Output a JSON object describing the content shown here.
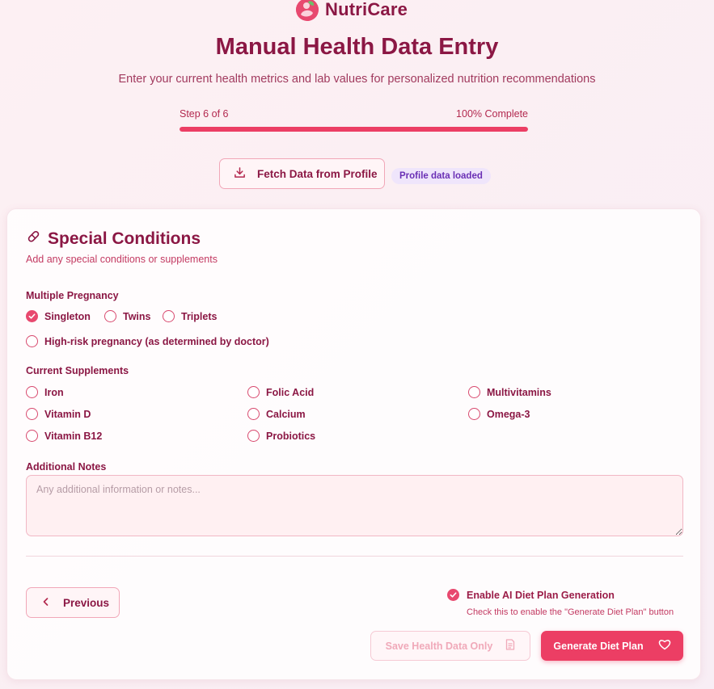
{
  "brand": {
    "name": "NutriCare"
  },
  "header": {
    "title": "Manual Health Data Entry",
    "subtitle": "Enter your current health metrics and lab values for personalized nutrition recommendations"
  },
  "progress": {
    "step_label": "Step 6 of 6",
    "complete_label": "100% Complete",
    "value": 1.0
  },
  "actions_top": {
    "fetch_label": "Fetch Data from Profile",
    "badge": "Profile data loaded"
  },
  "section": {
    "title": "Special Conditions",
    "subtitle": "Add any special conditions or supplements"
  },
  "pregnancy": {
    "label": "Multiple Pregnancy",
    "options": [
      {
        "label": "Singleton",
        "checked": true
      },
      {
        "label": "Twins",
        "checked": false
      },
      {
        "label": "Triplets",
        "checked": false
      }
    ],
    "high_risk": {
      "label": "High-risk pregnancy (as determined by doctor)",
      "checked": false
    }
  },
  "supplements": {
    "label": "Current Supplements",
    "items": [
      {
        "label": "Iron",
        "checked": false
      },
      {
        "label": "Folic Acid",
        "checked": false
      },
      {
        "label": "Multivitamins",
        "checked": false
      },
      {
        "label": "Vitamin D",
        "checked": false
      },
      {
        "label": "Calcium",
        "checked": false
      },
      {
        "label": "Omega-3",
        "checked": false
      },
      {
        "label": "Vitamin B12",
        "checked": false
      },
      {
        "label": "Probiotics",
        "checked": false
      }
    ]
  },
  "notes": {
    "label": "Additional Notes",
    "placeholder": "Any additional information or notes...",
    "value": ""
  },
  "footer": {
    "previous_label": "Previous",
    "ai_toggle": {
      "title": "Enable AI Diet Plan Generation",
      "description": "Check this to enable the \"Generate Diet Plan\" button",
      "checked": true
    },
    "save_label": "Save Health Data Only",
    "generate_label": "Generate Diet Plan"
  },
  "colors": {
    "accent": "#ec3e64",
    "brand_text": "#8b1744",
    "badge_bg": "#efe5fb",
    "badge_text": "#6a2fb5"
  }
}
